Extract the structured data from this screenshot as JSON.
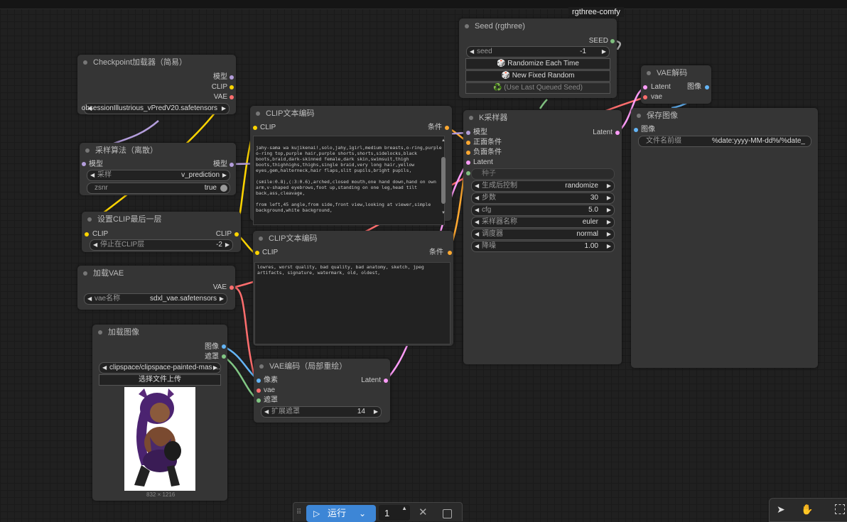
{
  "app": {
    "brand": "rgthree-comfy"
  },
  "nodes": {
    "checkpoint": {
      "title": "Checkpoint加载器（简易）",
      "outputs": [
        "模型",
        "CLIP",
        "VAE"
      ],
      "ckpt_value": "obsessionIllustrious_vPredV20.safetensors"
    },
    "sampling": {
      "title": "采样算法（离散）",
      "input": "模型",
      "output": "模型",
      "sampling_label": "采样",
      "sampling_value": "v_prediction",
      "zsnr_label": "zsnr",
      "zsnr_value": "true"
    },
    "clipskip": {
      "title": "设置CLIP最后一层",
      "input": "CLIP",
      "output": "CLIP",
      "stop_label": "停止在CLIP层",
      "stop_value": "-2"
    },
    "loadvae": {
      "title": "加载VAE",
      "output": "VAE",
      "name_label": "vae名称",
      "name_value": "sdxl_vae.safetensors"
    },
    "loadimage": {
      "title": "加载图像",
      "outputs": [
        "图像",
        "遮罩"
      ],
      "image_value": "clipspace/clipspace-painted-mas ...",
      "upload_label": "选择文件上传",
      "size_caption": "832 × 1216"
    },
    "clip_pos": {
      "title": "CLIP文本编码",
      "input": "CLIP",
      "output": "条件",
      "text": "jahy-sama wa kujikenai!,solo,jahy,1girl,medium breasts,o-ring,purple o-ring top,purple hair,purple shorts,shorts,sidelocks,black boots,braid,dark-skinned female,dark skin,swimsuit,thigh boots,thighhighs,thighs,single braid,very long hair,yellow eyes,gem,halterneck,hair flaps,slit pupils,bright pupils,\n\n(smile:0.8),(:3:0.6),arched,closed mouth,one hand down,hand on own arm,v-shaped eyebrows,foot up,standing on one leg,head tilt back,ass,cleavage,\n\nfrom left,45 angle,from side,front view,looking at viewer,simple background,white background,"
    },
    "clip_neg": {
      "title": "CLIP文本编码",
      "input": "CLIP",
      "output": "条件",
      "text": "lowres, worst quality, bad quality, bad anatomy, sketch, jpeg artifacts, signature, watermark, old, oldest,"
    },
    "vaeencode": {
      "title": "VAE编码（局部重绘）",
      "inputs": [
        "像素",
        "vae",
        "遮罩"
      ],
      "output": "Latent",
      "grow_label": "扩展遮罩",
      "grow_value": "14"
    },
    "seed": {
      "title": "Seed (rgthree)",
      "output": "SEED",
      "seed_label": "seed",
      "seed_value": "-1",
      "btn_randomize": "🎲 Randomize Each Time",
      "btn_new_fixed": "🎲 New Fixed Random",
      "btn_last": "♻️ (Use Last Queued Seed)"
    },
    "ksampler": {
      "title": "K采样器",
      "inputs": [
        "模型",
        "正面条件",
        "负面条件",
        "Latent"
      ],
      "output": "Latent",
      "seed_input": "种子",
      "widgets": [
        {
          "label": "生成后控制",
          "value": "randomize"
        },
        {
          "label": "步数",
          "value": "30"
        },
        {
          "label": "cfg",
          "value": "5.0"
        },
        {
          "label": "采样器名称",
          "value": "euler"
        },
        {
          "label": "调度器",
          "value": "normal"
        },
        {
          "label": "降噪",
          "value": "1.00"
        }
      ]
    },
    "vaedecode": {
      "title": "VAE解码",
      "inputs": [
        "Latent",
        "vae"
      ],
      "output": "图像"
    },
    "saveimage": {
      "title": "保存图像",
      "input": "图像",
      "prefix_label": "文件名前缀",
      "prefix_value": "%date:yyyy-MM-dd%/%date_"
    }
  },
  "toolbar": {
    "run_label": "运行",
    "count": "1"
  },
  "colors": {
    "model": "#b39ddb",
    "clip": "#ffd500",
    "vae": "#ff6e6e",
    "conditioning": "#ffa931",
    "latent": "#ff9cf9",
    "image": "#64b5f6",
    "mask": "#81c784",
    "int": "#7fbf7f",
    "accent": "#3d86d6"
  }
}
